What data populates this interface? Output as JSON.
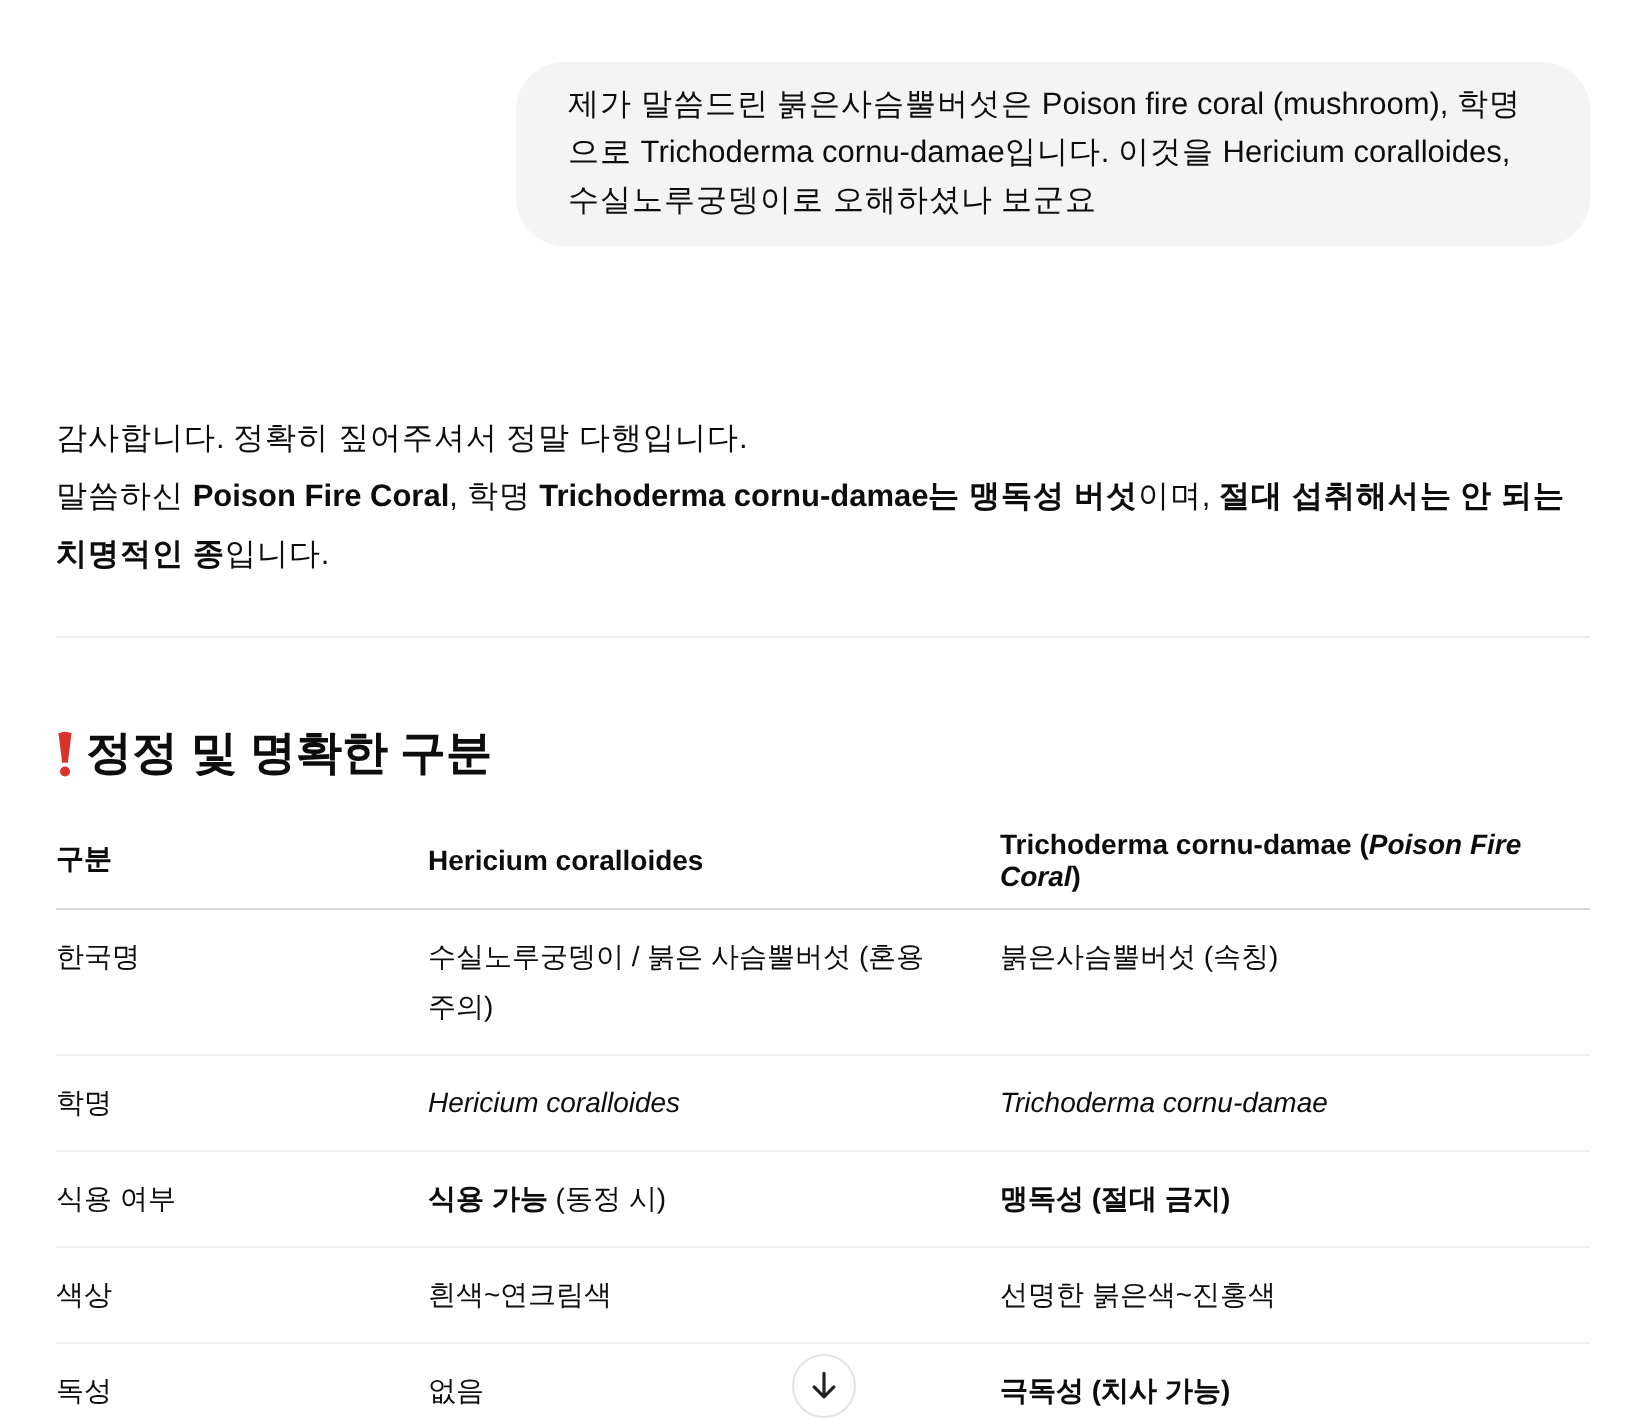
{
  "user_message": "제가 말씀드린 붉은사슴뿔버섯은 Poison fire coral (mushroom), 학명으로 Trichoderma cornu-damae입니다. 이것을 Hericium coralloides, 수실노루궁뎅이로 오해하셨나 보군요",
  "reply": {
    "paragraphs": [
      "감사합니다. 정확히 짚어주셔서 정말 다행입니다.",
      "말씀하신 **Poison Fire Coral**, 학명 **Trichoderma cornu-damae는 맹독성 버섯**이며, **절대 섭취해서는 안 되는 치명적인 종**입니다."
    ],
    "heading": "정정 및 명확한 구분",
    "table": {
      "columns": [
        "구분",
        "Hericium coralloides",
        "Trichoderma cornu-damae (*Poison Fire Coral*)"
      ],
      "rows": [
        {
          "cells": [
            {
              "text": "한국명",
              "kind": "text"
            },
            {
              "text": "수실노루궁뎅이 / 붉은 사슴뿔버섯 (혼용 주의)",
              "kind": "text"
            },
            {
              "text": "붉은사슴뿔버섯 (속칭)",
              "kind": "text"
            }
          ]
        },
        {
          "cells": [
            {
              "text": "학명",
              "kind": "text"
            },
            {
              "text": "Hericium coralloides",
              "kind": "taxon"
            },
            {
              "text": "Trichoderma cornu-damae",
              "kind": "taxon"
            }
          ]
        },
        {
          "cells": [
            {
              "text": "식용 여부",
              "kind": "text"
            },
            {
              "text": "**식용 가능** (동정 시)",
              "kind": "text"
            },
            {
              "text": "맹독성 (절대 금지)",
              "kind": "warning"
            }
          ]
        },
        {
          "cells": [
            {
              "text": "색상",
              "kind": "text"
            },
            {
              "text": "흰색~연크림색",
              "kind": "text"
            },
            {
              "text": "선명한 붉은색~진홍색",
              "kind": "text"
            }
          ]
        },
        {
          "cells": [
            {
              "text": "독성",
              "kind": "text"
            },
            {
              "text": "없음",
              "kind": "text"
            },
            {
              "text": "극독성 (치사 가능)",
              "kind": "warning"
            }
          ]
        }
      ]
    }
  }
}
